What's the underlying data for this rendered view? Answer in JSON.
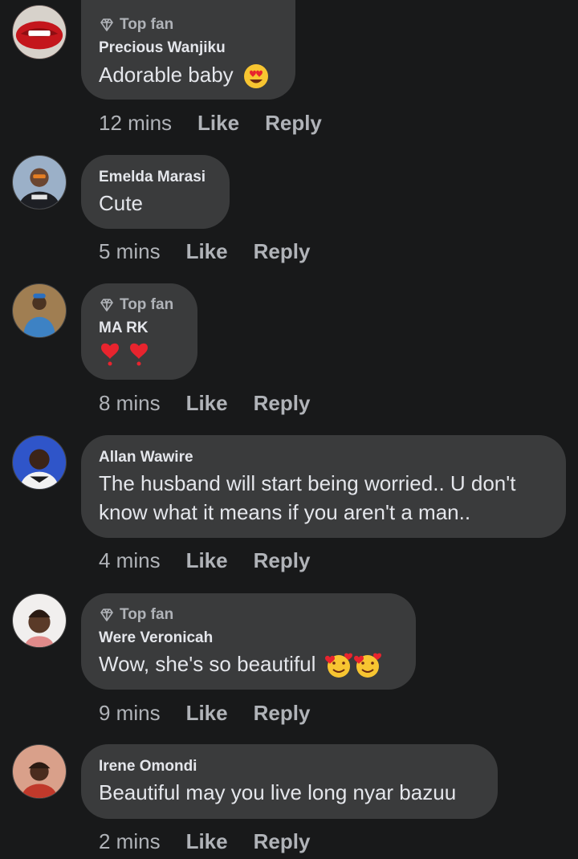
{
  "comments": [
    {
      "author": "Precious Wanjiku",
      "badge": "Top fan",
      "text": "Adorable baby",
      "emoji": "heart-eyes",
      "time": "12 mins",
      "like": "Like",
      "reply": "Reply"
    },
    {
      "author": "Emelda Marasi",
      "text": "Cute",
      "time": "5 mins",
      "like": "Like",
      "reply": "Reply"
    },
    {
      "author": "MA RK",
      "badge": "Top fan",
      "text": "",
      "emoji": "red-hearts",
      "time": "8 mins",
      "like": "Like",
      "reply": "Reply"
    },
    {
      "author": "Allan Wawire",
      "text_line1": "The husband will start being worried.. U don't",
      "text_line2": "know what it means if you aren't a man..",
      "time": "4 mins",
      "like": "Like",
      "reply": "Reply"
    },
    {
      "author": "Were Veronicah",
      "badge": "Top fan",
      "text": "Wow, she's so beautiful",
      "emoji": "smiling-face-with-hearts",
      "time": "9 mins",
      "like": "Like",
      "reply": "Reply"
    },
    {
      "author": "Irene Omondi",
      "text": "Beautiful may you live long nyar bazuu",
      "time": "2 mins",
      "like": "Like",
      "reply": "Reply"
    }
  ],
  "colors": {
    "background": "#18191a",
    "bubble": "#3a3b3c",
    "primary_text": "#e4e6eb",
    "secondary_text": "#b0b3b8"
  }
}
